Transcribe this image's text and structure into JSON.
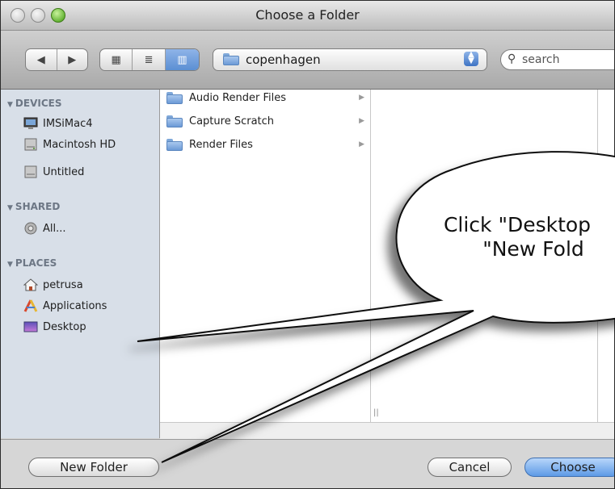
{
  "window": {
    "title": "Choose a Folder"
  },
  "toolbar": {
    "nav_back_icon": "arrow-left-icon",
    "nav_forward_icon": "arrow-right-icon",
    "view_icon_glyph": "▦",
    "view_list_glyph": "≣",
    "view_column_glyph": "▥",
    "location": "copenhagen",
    "search_placeholder": "search",
    "search_glyph": "🔍"
  },
  "sidebar": {
    "devices_title": "DEVICES",
    "devices": [
      {
        "label": "IMSiMac4",
        "icon": "imac-icon"
      },
      {
        "label": "Macintosh HD",
        "icon": "hard-drive-icon"
      },
      {
        "label": "Untitled",
        "icon": "hard-drive-icon"
      }
    ],
    "shared_title": "SHARED",
    "shared": [
      {
        "label": "All...",
        "icon": "network-icon"
      }
    ],
    "places_title": "PLACES",
    "places": [
      {
        "label": "petrusa",
        "icon": "home-icon"
      },
      {
        "label": "Applications",
        "icon": "applications-icon"
      },
      {
        "label": "Desktop",
        "icon": "desktop-icon"
      }
    ]
  },
  "browser": {
    "column1": [
      {
        "label": "Audio Render Files"
      },
      {
        "label": "Capture Scratch"
      },
      {
        "label": "Render Files"
      }
    ],
    "resize_glyph": "||"
  },
  "buttons": {
    "new_folder": "New Folder",
    "cancel": "Cancel",
    "choose": "Choose"
  },
  "callout": {
    "line1": "Click \"Desktop",
    "line2": "\"New Fold"
  }
}
